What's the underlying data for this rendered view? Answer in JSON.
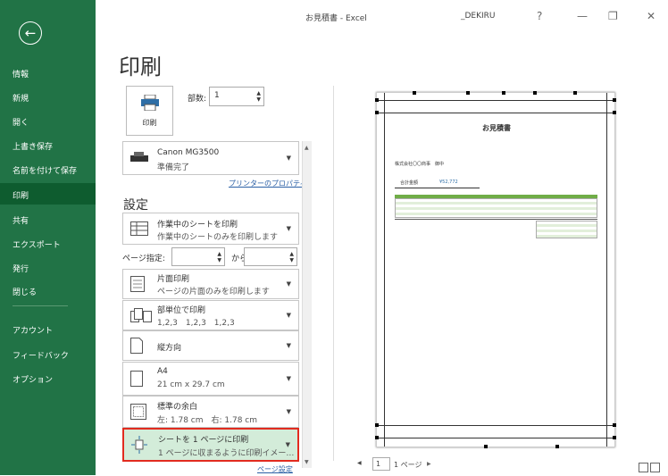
{
  "window": {
    "title": "お見積書 - Excel",
    "user": "_DEKIRU",
    "help": "?",
    "minimize": "—",
    "restore": "❐",
    "close": "✕"
  },
  "sidebar": {
    "back": "←",
    "items": [
      "情報",
      "新規",
      "開く",
      "上書き保存",
      "名前を付けて保存",
      "印刷",
      "共有",
      "エクスポート",
      "発行",
      "閉じる",
      "アカウント",
      "フィードバック",
      "オプション"
    ]
  },
  "print": {
    "page_title": "印刷",
    "print_button": "印刷",
    "copies_label": "部数:",
    "copies_value": "1",
    "printer_name": "Canon MG3500",
    "printer_status": "準備完了",
    "printer_props_link": "プリンターのプロパティ",
    "settings_heading": "設定",
    "scope_main": "作業中のシートを印刷",
    "scope_sub": "作業中のシートのみを印刷します",
    "pages_label": "ページ指定:",
    "pages_to": "から",
    "sides_main": "片面印刷",
    "sides_sub": "ページの片面のみを印刷します",
    "collate_main": "部単位で印刷",
    "collate_sub": "1,2,3　1,2,3　1,2,3",
    "orientation": "縦方向",
    "paper_main": "A4",
    "paper_sub": "21 cm x 29.7 cm",
    "margin_main": "標準の余白",
    "margin_sub": "左: 1.78 cm　右: 1.78 cm",
    "scale_main": "シートを 1 ページに印刷",
    "scale_sub": "1 ページに収まるように印刷イメー…",
    "page_setup_link": "ページ設定"
  },
  "preview": {
    "doc_title": "お見積書",
    "company": "株式会社〇〇商事　御中",
    "amount_label": "合計金額",
    "amount": "¥52,772",
    "current_page": "1",
    "page_total": "1 ページ",
    "prev": "◀",
    "next": "▶"
  },
  "colors": {
    "sidebar": "#217346",
    "active": "#0e5c2f",
    "highlight": "#e22b1f",
    "selected_fill": "#d3ecd9",
    "table_header": "#70ad47"
  }
}
